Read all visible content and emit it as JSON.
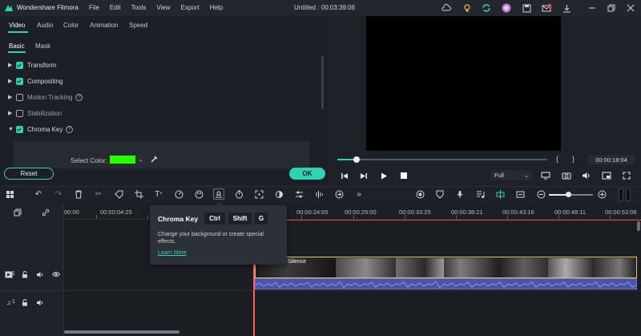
{
  "app": {
    "name": "Wondershare Filmora",
    "title": "Untitled : 00:03:39:06",
    "menu": [
      "File",
      "Edit",
      "Tools",
      "View",
      "Export",
      "Help"
    ]
  },
  "editor": {
    "tabs": [
      "Video",
      "Audio",
      "Color",
      "Animation",
      "Speed"
    ],
    "active_tab": "Video",
    "subtabs": [
      "Basic",
      "Mask"
    ],
    "active_subtab": "Basic",
    "properties": [
      {
        "label": "Transform",
        "checked": true,
        "expanded": false
      },
      {
        "label": "Compositing",
        "checked": true,
        "expanded": false
      },
      {
        "label": "Motion Tracking",
        "checked": false,
        "expanded": false,
        "help": "?"
      },
      {
        "label": "Stabilization",
        "checked": false,
        "expanded": false
      },
      {
        "label": "Chroma Key",
        "checked": true,
        "expanded": true,
        "help": "?"
      }
    ],
    "select_color_label": "Select Color:",
    "selected_color": "#26ff00",
    "reset_label": "Reset",
    "ok_label": "OK"
  },
  "preview": {
    "progress_fraction": 0.09,
    "brace_left": "{",
    "brace_right": "}",
    "timecode": "00:00:18:04",
    "quality": "Full"
  },
  "timeline": {
    "ruler_labels": [
      "00:00",
      "00:00:04:25",
      "00:00:24:05",
      "00:00:29:00",
      "00:00:33:25",
      "00:00:38:21",
      "00:00:43:16",
      "00:00:48:11",
      "00:00:53:06"
    ],
    "video_track_number": "1",
    "audio_track_number": "1",
    "clip_title": "ples - Silence"
  },
  "tooltip": {
    "title": "Chroma Key",
    "keys": [
      "Ctrl",
      "Shift",
      "G"
    ],
    "description": "Change your background or create special effects.",
    "link": "Learn More"
  },
  "colors": {
    "accent": "#2fd3b2",
    "playhead": "#ff5c5c",
    "audio_clip": "#4a55a8"
  }
}
